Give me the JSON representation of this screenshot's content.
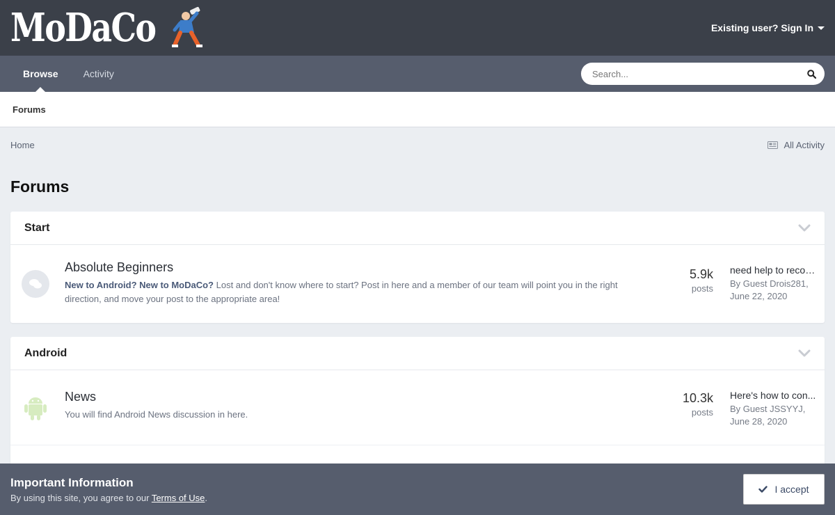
{
  "header": {
    "logo_text": "MoDaCo",
    "signin_label": "Existing user? Sign In"
  },
  "nav": {
    "tabs": [
      {
        "label": "Browse",
        "active": true
      },
      {
        "label": "Activity",
        "active": false
      }
    ],
    "search_placeholder": "Search..."
  },
  "subnav": {
    "items": [
      {
        "label": "Forums"
      }
    ]
  },
  "breadcrumb": {
    "home": "Home",
    "all_activity": "All Activity"
  },
  "page": {
    "title": "Forums"
  },
  "categories": [
    {
      "title": "Start",
      "forums": [
        {
          "title": "Absolute Beginners",
          "desc_bold": "New to Android? New to MoDaCo?",
          "desc": " Lost and don't know where to start? Post in here and a member of our team will point you in the right direction, and move your post to the appropriate area!",
          "count": "5.9k",
          "count_label": "posts",
          "last_title": "need help to recov...",
          "last_by": "By Guest Drois281,",
          "last_date": "June 22, 2020",
          "icon": "chat-bubbles-icon"
        }
      ]
    },
    {
      "title": "Android",
      "forums": [
        {
          "title": "News",
          "desc_bold": "",
          "desc": "You will find Android News discussion in here.",
          "count": "10.3k",
          "count_label": "posts",
          "last_title": "Here's how to con...",
          "last_by": "By Guest JSSYYJ,",
          "last_date": "June 28, 2020",
          "icon": "android-icon"
        }
      ]
    }
  ],
  "cookie": {
    "title": "Important Information",
    "text": "By using this site, you agree to our ",
    "link": "Terms of Use",
    "suffix": ".",
    "accept_label": "I accept"
  },
  "colors": {
    "header_bg": "#3b4049",
    "nav_bg": "#565d6d",
    "page_bg": "#ebeef2",
    "android_green": "#d7ecc0"
  }
}
